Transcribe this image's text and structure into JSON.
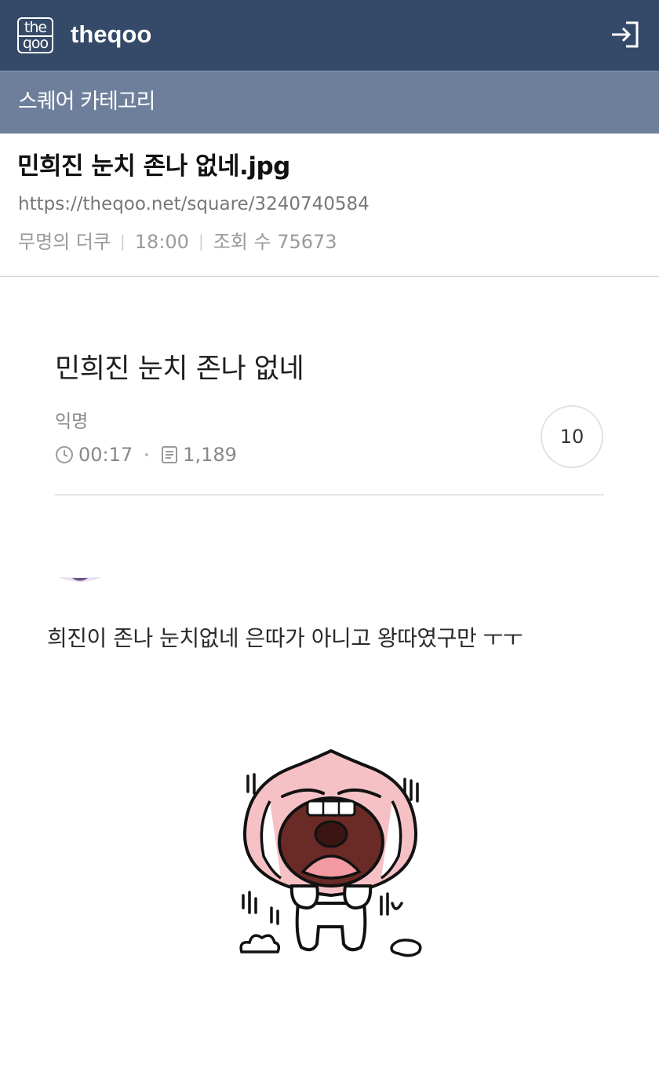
{
  "header": {
    "logo_line1": "the",
    "logo_line2": "qoo",
    "brand": "theqoo",
    "login_icon": "login-icon"
  },
  "category": {
    "label": "스퀘어 카테고리"
  },
  "post": {
    "title": "민희진 눈치 존나 없네.jpg",
    "url": "https://theqoo.net/square/3240740584",
    "author": "무명의 더쿠",
    "time": "18:00",
    "views_label": "조회 수 75673"
  },
  "embedded": {
    "title": "민희진 눈치 존나 없네",
    "author": "익명",
    "time": "00:17",
    "views": "1,189",
    "comment_count": "10",
    "comment_text": "희진이 존나 눈치없네 은따가 아니고 왕따였구만 ㅜㅜ"
  },
  "colors": {
    "topbar": "#344a68",
    "category_bar": "#6e7f9c"
  }
}
